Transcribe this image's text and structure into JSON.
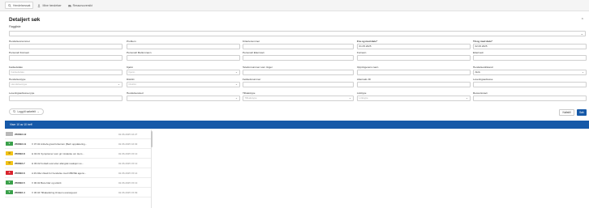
{
  "tabs": [
    {
      "label": "Hendelsessøk",
      "icon": "search-icon"
    },
    {
      "label": "Mine hendelser",
      "icon": "user-icon"
    },
    {
      "label": "Ressursoversikt",
      "icon": "vehicle-icon"
    }
  ],
  "page": {
    "title": "Detaljert søk",
    "subtitle": "Flaggliste"
  },
  "form": {
    "row1": [
      {
        "label": "Hendelsesnummer",
        "value": ""
      },
      {
        "label": "Problem",
        "value": ""
      },
      {
        "label": "Kriterienummer",
        "value": ""
      },
      {
        "label": "Fra og med dato*",
        "value": "01.05.2025",
        "bold": true
      },
      {
        "label": "Til og med dato*",
        "value": "02.06.2025",
        "bold": true
      }
    ],
    "row2": [
      {
        "label": "Personell Fornavn",
        "value": ""
      },
      {
        "label": "Personell Mellomnavn",
        "value": ""
      },
      {
        "label": "Personell Etternavn",
        "value": ""
      },
      {
        "label": "Fornavn",
        "value": ""
      },
      {
        "label": "Etternavn",
        "value": ""
      }
    ],
    "row3": [
      {
        "label": "Fødselsdato",
        "value": "",
        "placeholder": "Fødselsdato"
      },
      {
        "label": "Kjønn",
        "value": "",
        "placeholder": "Kjønn",
        "select": true
      },
      {
        "label": "Telefonnummer som ringer",
        "value": ""
      },
      {
        "label": "Oppringerens navn",
        "value": ""
      },
      {
        "label": "Hendelsestilstand",
        "value": "Aktiv",
        "select": true
      }
    ],
    "row4": [
      {
        "label": "Hendelsestype",
        "value": "",
        "placeholder": "Hendelsestype",
        "select": true
      },
      {
        "label": "Distrikt",
        "value": "",
        "placeholder": "Distrikt",
        "select": true
      },
      {
        "label": "Fødselsnummer",
        "value": ""
      },
      {
        "label": "Alternativ ID",
        "value": ""
      },
      {
        "label": "Leveringsadresse",
        "value": ""
      }
    ],
    "row5": [
      {
        "label": "Leveringsadresse-type",
        "value": ""
      },
      {
        "label": "Hendelsessted",
        "value": "",
        "select": true
      },
      {
        "label": "Tilbakstype",
        "value": "",
        "placeholder": "Tilbakstype",
        "select": true
      },
      {
        "label": "Linktype",
        "value": "",
        "placeholder": "Linktype",
        "select": true
      },
      {
        "label": "Ressursnavn",
        "value": ""
      }
    ]
  },
  "actions": {
    "logg_label": "Logg til søkefelt",
    "reset_label": "Nullstill",
    "search_label": "Søk"
  },
  "results": {
    "summary": "Viser 10 av 10 treff",
    "rows": [
      {
        "badge": "",
        "badge_color": "#b8b8b8",
        "badge_text_color": "#333",
        "id": "250602-12",
        "desc": "",
        "date": "02.06.2025 16:27"
      },
      {
        "badge": "V",
        "badge_color": "#3aa04a",
        "badge_text_color": "#fff",
        "id": "250602-11",
        "desc": "V 07.02 Anbefa gravit kriterium (Berit oppdatering...",
        "date": "02.06.2025 16:03"
      },
      {
        "badge": "H",
        "badge_color": "#f2c318",
        "badge_text_color": "#333",
        "id": "250602-8",
        "desc": "H 04.01 Symptomer som gir mistanke om Hem...",
        "date": "02.06.2025 15:13"
      },
      {
        "badge": "H",
        "badge_color": "#f2c318",
        "badge_text_color": "#333",
        "id": "250602-7",
        "desc": "H 06.02 Forkalt uvel etter allergisk reaksjon so...",
        "date": "02.06.2025 15:13"
      },
      {
        "badge": "A",
        "badge_color": "#d9232d",
        "badge_text_color": "#fff",
        "id": "250602-6",
        "desc": "A 29.04a Utsatt for hendelse med CBRNE agens...",
        "date": "02.06.2025 15:14"
      },
      {
        "badge": "V",
        "badge_color": "#3aa04a",
        "badge_text_color": "#fff",
        "id": "250602-5",
        "desc": "V 06.02 Bare blør og utskrit",
        "date": "02.06.2025 15:13"
      },
      {
        "badge": "V",
        "badge_color": "#3aa04a",
        "badge_text_color": "#fff",
        "id": "250602-4",
        "desc": "V 36.04 Tilbakeføring til kaom-sosiorgevet",
        "date": "02.06.2025 15:09"
      }
    ]
  }
}
